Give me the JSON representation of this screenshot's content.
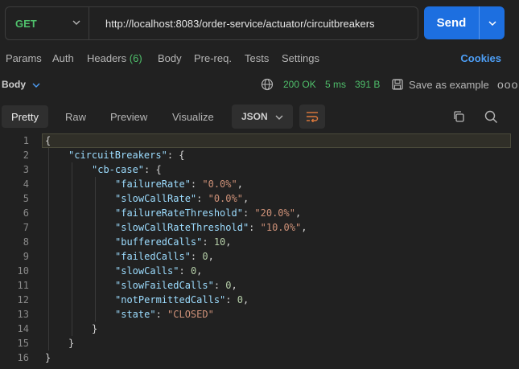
{
  "request": {
    "method": "GET",
    "url": "http://localhost:8083/order-service/actuator/circuitbreakers",
    "send_label": "Send"
  },
  "request_tabs": {
    "params": "Params",
    "auth": "Auth",
    "headers": "Headers",
    "headers_count": "(6)",
    "body": "Body",
    "prereq": "Pre-req.",
    "tests": "Tests",
    "settings": "Settings",
    "cookies": "Cookies"
  },
  "response": {
    "body_label": "Body",
    "status": "200 OK",
    "time": "5 ms",
    "size": "391 B",
    "save_label": "Save as example",
    "more": "ooo"
  },
  "view": {
    "tabs": [
      "Pretty",
      "Raw",
      "Preview",
      "Visualize"
    ],
    "active_tab": "Pretty",
    "format": "JSON"
  },
  "code_lines": [
    {
      "n": "1",
      "text": "{"
    },
    {
      "n": "2",
      "key": "\"circuitBreakers\"",
      "rest": ": {"
    },
    {
      "n": "3",
      "key": "\"cb-case\"",
      "rest": ": {"
    },
    {
      "n": "4",
      "key": "\"failureRate\"",
      "str": "\"0.0%\"",
      "rest": ","
    },
    {
      "n": "5",
      "key": "\"slowCallRate\"",
      "str": "\"0.0%\"",
      "rest": ","
    },
    {
      "n": "6",
      "key": "\"failureRateThreshold\"",
      "str": "\"20.0%\"",
      "rest": ","
    },
    {
      "n": "7",
      "key": "\"slowCallRateThreshold\"",
      "str": "\"10.0%\"",
      "rest": ","
    },
    {
      "n": "8",
      "key": "\"bufferedCalls\"",
      "num": "10",
      "rest": ","
    },
    {
      "n": "9",
      "key": "\"failedCalls\"",
      "num": "0",
      "rest": ","
    },
    {
      "n": "10",
      "key": "\"slowCalls\"",
      "num": "0",
      "rest": ","
    },
    {
      "n": "11",
      "key": "\"slowFailedCalls\"",
      "num": "0",
      "rest": ","
    },
    {
      "n": "12",
      "key": "\"notPermittedCalls\"",
      "num": "0",
      "rest": ","
    },
    {
      "n": "13",
      "key": "\"state\"",
      "str": "\"CLOSED\"",
      "rest": ""
    },
    {
      "n": "14",
      "text": "}"
    },
    {
      "n": "15",
      "text": "}"
    },
    {
      "n": "16",
      "text": "}"
    }
  ],
  "colors": {
    "accent": "#1d6fe0",
    "success": "#4fbf6b",
    "link": "#4d9ef5",
    "background": "#212121"
  }
}
